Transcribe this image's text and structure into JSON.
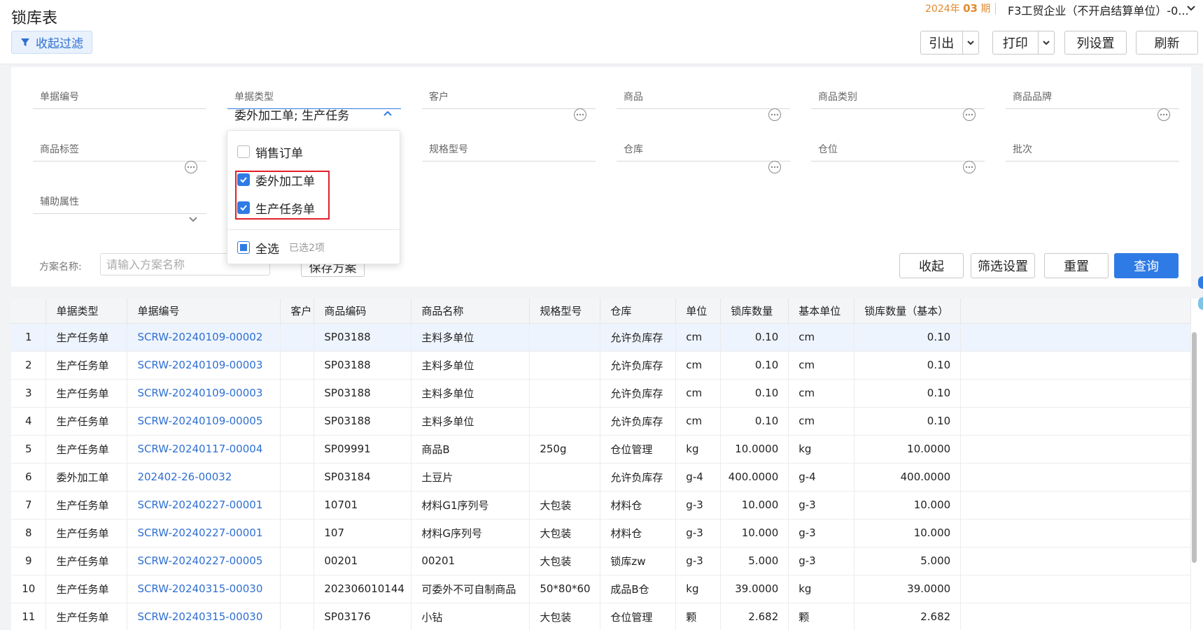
{
  "header": {
    "title": "锁库表",
    "filter_toggle": "收起过滤",
    "period_year": "2024年",
    "period_num": "03",
    "period_suffix": "期",
    "company": "F3工贸企业（不开启结算单位）-0...",
    "toolbar": {
      "export": "引出",
      "print": "打印",
      "columns": "列设置",
      "refresh": "刷新"
    }
  },
  "filters": {
    "doc_no": {
      "label": "单据编号",
      "value": ""
    },
    "doc_type": {
      "label": "单据类型",
      "value": "委外加工单;   生产任务"
    },
    "customer": {
      "label": "客户",
      "value": ""
    },
    "product": {
      "label": "商品",
      "value": ""
    },
    "product_category": {
      "label": "商品类别",
      "value": ""
    },
    "product_brand": {
      "label": "商品品牌",
      "value": ""
    },
    "product_tag": {
      "label": "商品标签",
      "value": ""
    },
    "spec_model": {
      "label": "规格型号",
      "value": ""
    },
    "warehouse": {
      "label": "仓库",
      "value": ""
    },
    "location": {
      "label": "仓位",
      "value": ""
    },
    "batch": {
      "label": "批次",
      "value": ""
    },
    "aux_attr": {
      "label": "辅助属性",
      "value": ""
    }
  },
  "dropdown": {
    "options": [
      {
        "label": "销售订单",
        "checked": false
      },
      {
        "label": "委外加工单",
        "checked": true
      },
      {
        "label": "生产任务单",
        "checked": true
      }
    ],
    "select_all": "全选",
    "selected_count": "已选2项"
  },
  "scheme": {
    "label": "方案名称:",
    "placeholder": "请输入方案名称",
    "save": "保存方案"
  },
  "filter_actions": {
    "collapse": "收起",
    "settings": "筛选设置",
    "reset": "重置",
    "query": "查询"
  },
  "table": {
    "columns": [
      "",
      "单据类型",
      "单据编号",
      "客户",
      "商品编码",
      "商品名称",
      "规格型号",
      "仓库",
      "单位",
      "锁库数量",
      "基本单位",
      "锁库数量（基本）"
    ],
    "rows": [
      [
        "1",
        "生产任务单",
        "SCRW-20240109-00002",
        "",
        "SP03188",
        "主料多单位",
        "",
        "允许负库存",
        "cm",
        "0.10",
        "cm",
        "0.10"
      ],
      [
        "2",
        "生产任务单",
        "SCRW-20240109-00003",
        "",
        "SP03188",
        "主料多单位",
        "",
        "允许负库存",
        "cm",
        "0.10",
        "cm",
        "0.10"
      ],
      [
        "3",
        "生产任务单",
        "SCRW-20240109-00003",
        "",
        "SP03188",
        "主料多单位",
        "",
        "允许负库存",
        "cm",
        "0.10",
        "cm",
        "0.10"
      ],
      [
        "4",
        "生产任务单",
        "SCRW-20240109-00005",
        "",
        "SP03188",
        "主料多单位",
        "",
        "允许负库存",
        "cm",
        "0.10",
        "cm",
        "0.10"
      ],
      [
        "5",
        "生产任务单",
        "SCRW-20240117-00004",
        "",
        "SP09991",
        "商品B",
        "250g",
        "仓位管理",
        "kg",
        "10.0000",
        "kg",
        "10.0000"
      ],
      [
        "6",
        "委外加工单",
        "202402-26-00032",
        "",
        "SP03184",
        "土豆片",
        "",
        "允许负库存",
        "g-4",
        "400.0000",
        "g-4",
        "400.0000"
      ],
      [
        "7",
        "生产任务单",
        "SCRW-20240227-00001",
        "",
        "10701",
        "材料G1序列号",
        "大包装",
        "材料仓",
        "g-3",
        "10.000",
        "g-3",
        "10.000"
      ],
      [
        "8",
        "生产任务单",
        "SCRW-20240227-00001",
        "",
        "107",
        "材料G序列号",
        "大包装",
        "材料仓",
        "g-3",
        "10.000",
        "g-3",
        "10.000"
      ],
      [
        "9",
        "生产任务单",
        "SCRW-20240227-00005",
        "",
        "00201",
        "00201",
        "大包装",
        "锁库zw",
        "g-3",
        "5.000",
        "g-3",
        "5.000"
      ],
      [
        "10",
        "生产任务单",
        "SCRW-20240315-00030",
        "",
        "202306010144",
        "可委外不可自制商品",
        "50*80*60",
        "成品B仓",
        "kg",
        "39.0000",
        "kg",
        "39.0000"
      ],
      [
        "11",
        "生产任务单",
        "SCRW-20240315-00030",
        "",
        "SP03176",
        "小钻",
        "大包装",
        "仓位管理",
        "颗",
        "2.682",
        "颗",
        "2.682"
      ]
    ],
    "selected_row": 1
  }
}
